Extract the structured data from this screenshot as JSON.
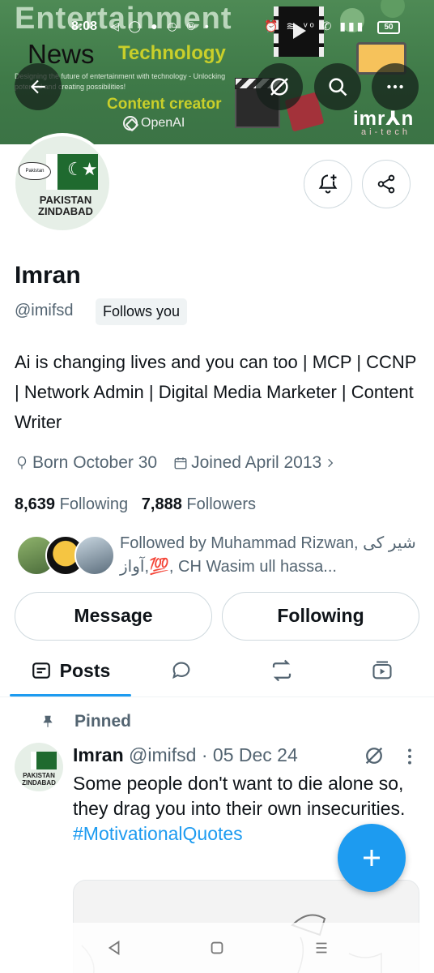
{
  "status_bar": {
    "time": "8:08",
    "left_icons": "◁ ◯ ● ◷ ℗ •",
    "right_icons": "⏰ ≋ ᵛᵒ ✆ ▮▮▮",
    "battery": "50"
  },
  "banner": {
    "big_title": "Entertainment",
    "news": "News",
    "technology": "Technology",
    "tagline": "Designing the future of entertainment with technology - Unlocking potential and creating possibilities!",
    "content_creator": "Content creator",
    "openai": "OpenAI",
    "brand": "imr⅄n",
    "brand_sub": "ai-tech"
  },
  "avatar_label": "PAKISTAN ZINDABAD",
  "avatar_badge": "Pakistan",
  "profile": {
    "name": "Imran",
    "handle": "@imifsd",
    "follows_you": "Follows you",
    "bio": "Ai is changing lives and you can too | MCP | CCNP | Network Admin | Digital Media Marketer | Content Writer",
    "born": "Born October 30",
    "joined": "Joined April 2013",
    "following_count": "8,639",
    "following_label": "Following",
    "followers_count": "7,888",
    "followers_label": "Followers",
    "followed_by": "Followed by Muhammad Rizwan, شیر کی آواز,💯, CH Wasim ull hassa..."
  },
  "buttons": {
    "message": "Message",
    "following": "Following"
  },
  "tabs": [
    {
      "label": "Posts",
      "icon": "posts-icon",
      "active": true
    },
    {
      "label": "",
      "icon": "replies-icon"
    },
    {
      "label": "",
      "icon": "reposts-icon"
    },
    {
      "label": "",
      "icon": "media-icon"
    }
  ],
  "post": {
    "pinned_label": "Pinned",
    "author": "Imran",
    "handle": "@imifsd",
    "separator": "·",
    "date": "05 Dec 24",
    "text": "Some people don't want to die alone so, they drag you into their own insecurities.",
    "hashtag": "#MotivationalQuotes",
    "avatar_label": "PAKISTAN ZINDABAD"
  },
  "colors": {
    "accent": "#1d9bf0",
    "banner_green": "#4e8a55",
    "muted_text": "#536471"
  }
}
